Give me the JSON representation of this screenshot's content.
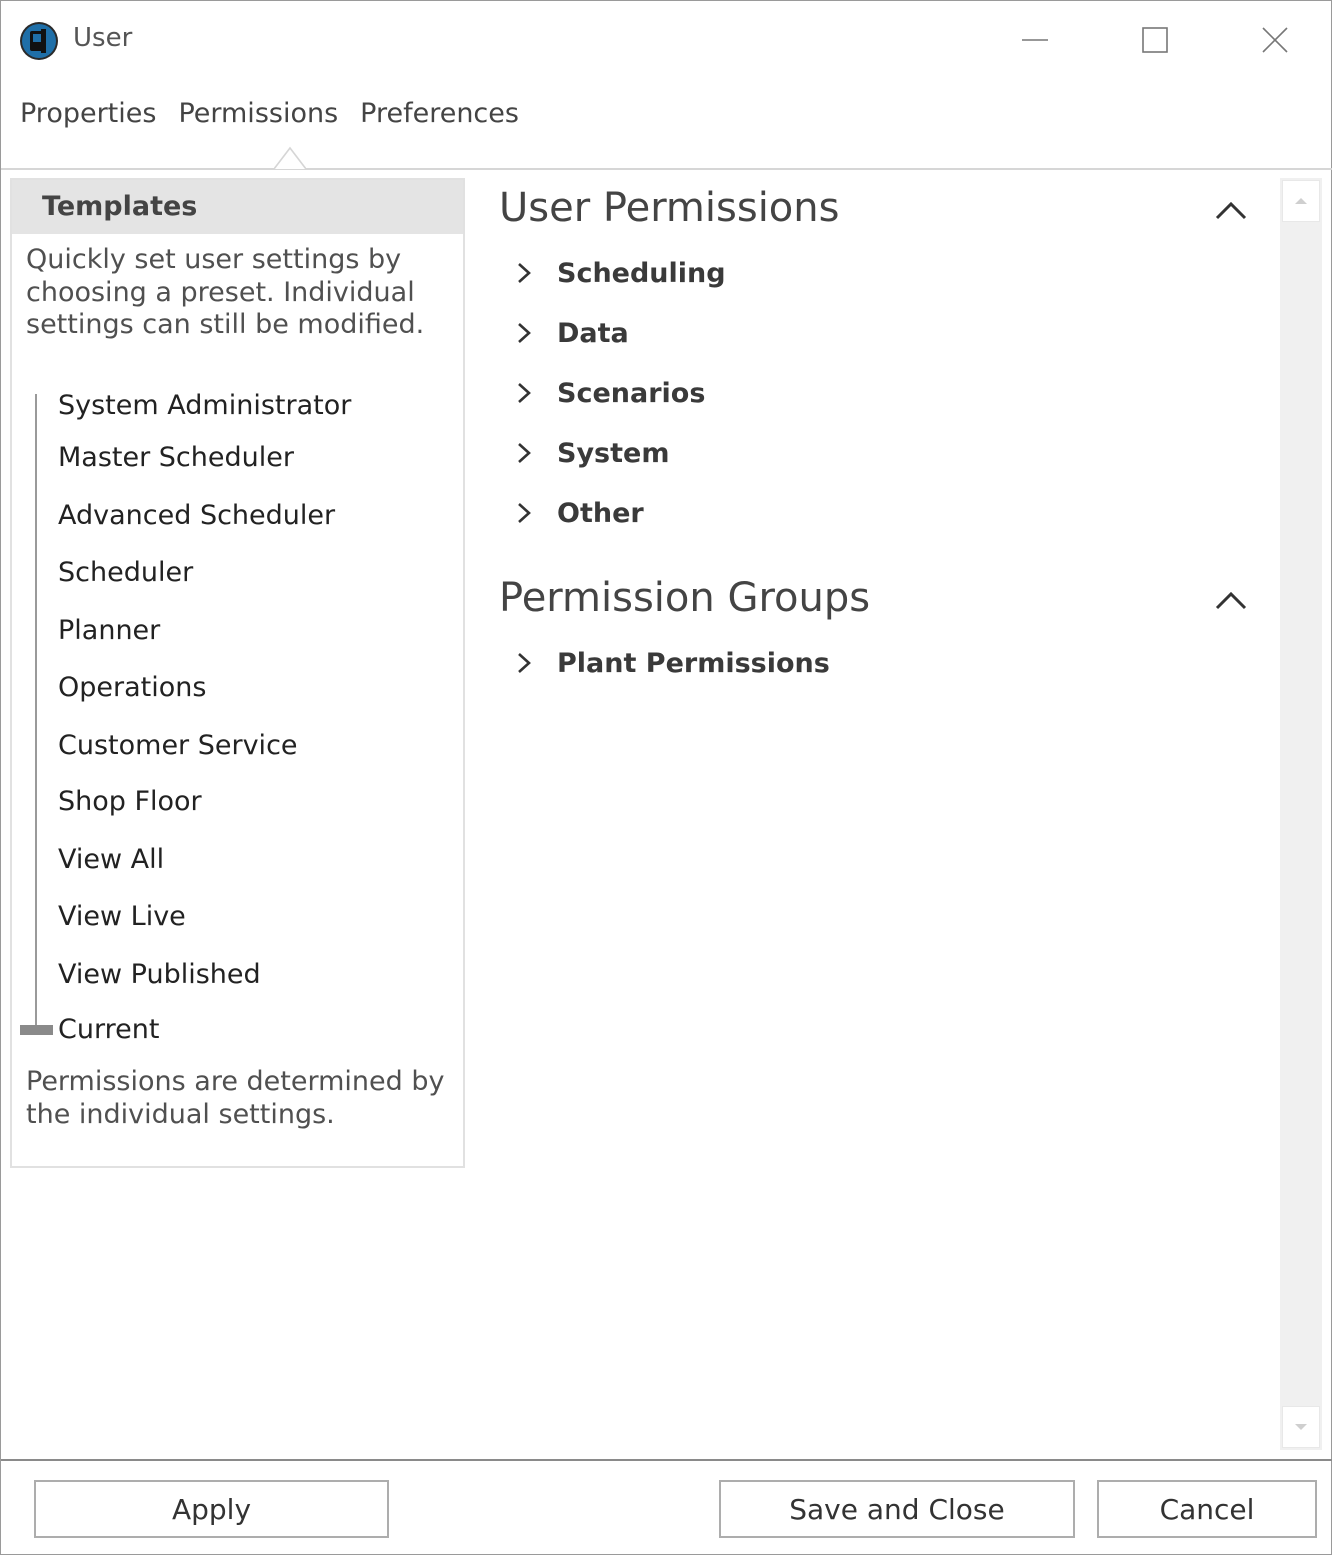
{
  "window": {
    "title": "User",
    "icon": "app-logo-icon",
    "controls": [
      "minimize-icon",
      "maximize-icon",
      "close-icon"
    ]
  },
  "tabs": [
    {
      "label": "Properties"
    },
    {
      "label": "Permissions",
      "selected": true
    },
    {
      "label": "Preferences"
    }
  ],
  "templates": {
    "header": "Templates",
    "description": "Quickly set user settings by choosing a preset. Individual settings can still be modified.",
    "presets": [
      "System Administrator",
      "Master Scheduler",
      "Advanced Scheduler",
      "Scheduler",
      "Planner",
      "Operations",
      "Customer Service",
      "Shop Floor",
      "View All",
      "View Live",
      "View Published",
      "Current"
    ],
    "selected_preset": "Current",
    "footer": "Permissions are determined by the individual settings."
  },
  "user_permissions": {
    "title": "User Permissions",
    "items": [
      "Scheduling",
      "Data",
      "Scenarios",
      "System",
      "Other"
    ]
  },
  "permission_groups": {
    "title": "Permission Groups",
    "items": [
      "Plant Permissions"
    ]
  },
  "buttons": {
    "apply": "Apply",
    "save_close": "Save and Close",
    "cancel": "Cancel"
  }
}
